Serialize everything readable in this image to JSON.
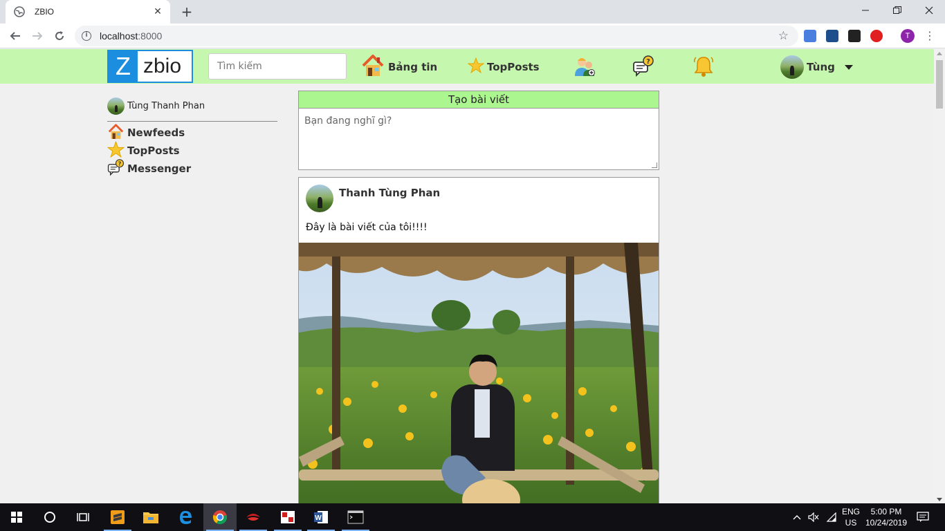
{
  "browser": {
    "tab_title": "ZBIO",
    "url_host": "localhost",
    "url_port": ":8000",
    "profile_initial": "T"
  },
  "site": {
    "logo_letter": "Z",
    "logo_text": "zbio",
    "search_placeholder": "Tìm kiếm",
    "nav": {
      "newsfeed_label": "Bảng tin",
      "topposts_label": "TopPosts",
      "user_name": "Tùng"
    }
  },
  "sidebar": {
    "profile_name": "Tùng Thanh Phan",
    "items": [
      {
        "label": "Newfeeds",
        "icon": "house-icon"
      },
      {
        "label": "TopPosts",
        "icon": "star-icon"
      },
      {
        "label": "Messenger",
        "icon": "chat-question-icon"
      }
    ]
  },
  "create_post": {
    "header": "Tạo bài viết",
    "placeholder": "Bạn đang nghĩ gì?"
  },
  "post": {
    "author": "Thanh Tùng Phan",
    "content": "Đây là bài viết của tôi!!!!"
  },
  "taskbar": {
    "lang_top": "ENG",
    "lang_bottom": "US",
    "time": "5:00 PM",
    "date": "10/24/2019"
  },
  "colors": {
    "nav_bg": "#c6f7ae",
    "create_header_bg": "#abf68f",
    "logo_blue": "#1c8ee0"
  }
}
